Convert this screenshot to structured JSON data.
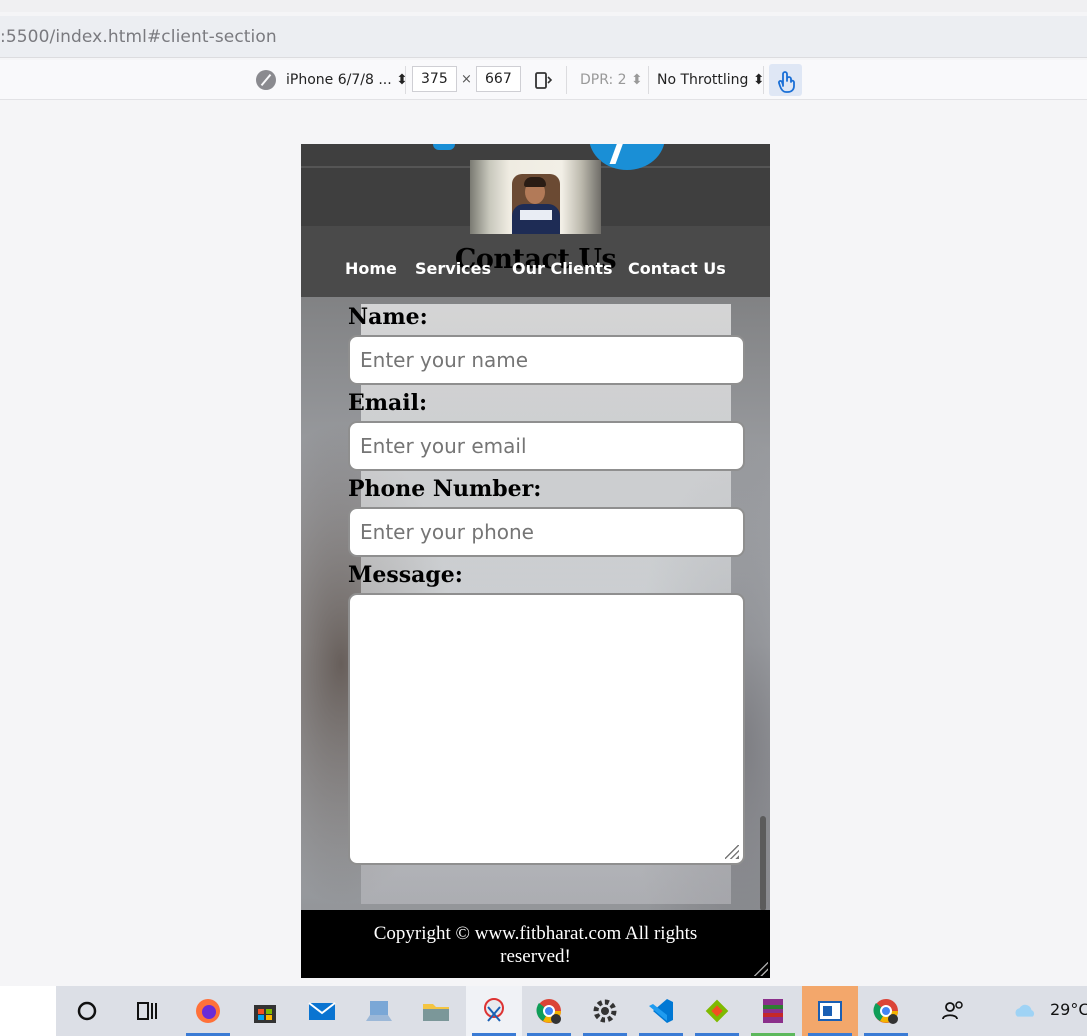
{
  "browser": {
    "url": ":5500/index.html#client-section",
    "device": "iPhone 6/7/8 ...",
    "width": "375",
    "height": "667",
    "dpr": "DPR: 2",
    "throttling": "No Throttling"
  },
  "site": {
    "nav": [
      "Home",
      "Services",
      "Our Clients",
      "Contact Us"
    ],
    "contact_heading": "Contact Us",
    "form": {
      "name_label": "Name:",
      "name_placeholder": "Enter your name",
      "email_label": "Email:",
      "email_placeholder": "Enter your email",
      "phone_label": "Phone Number:",
      "phone_placeholder": "Enter your phone",
      "message_label": "Message:"
    },
    "footer": "Copyright © www.fitbharat.com All rights reserved!"
  },
  "taskbar": {
    "temperature": "29°C",
    "apps": [
      "cortana-icon",
      "task-view-icon",
      "firefox-icon",
      "store-icon",
      "mail-icon",
      "computer-icon",
      "file-explorer-icon",
      "snipping-tool-icon",
      "chrome-icon",
      "settings-icon",
      "vscode-icon",
      "git-icon",
      "winrar-icon",
      "reader-icon",
      "chrome-icon",
      "people-icon",
      "weather-icon"
    ]
  },
  "colors": {
    "accent_blue": "#1a8fd6",
    "header_bg": "#3f3f3f",
    "footer_bg": "#000000"
  }
}
